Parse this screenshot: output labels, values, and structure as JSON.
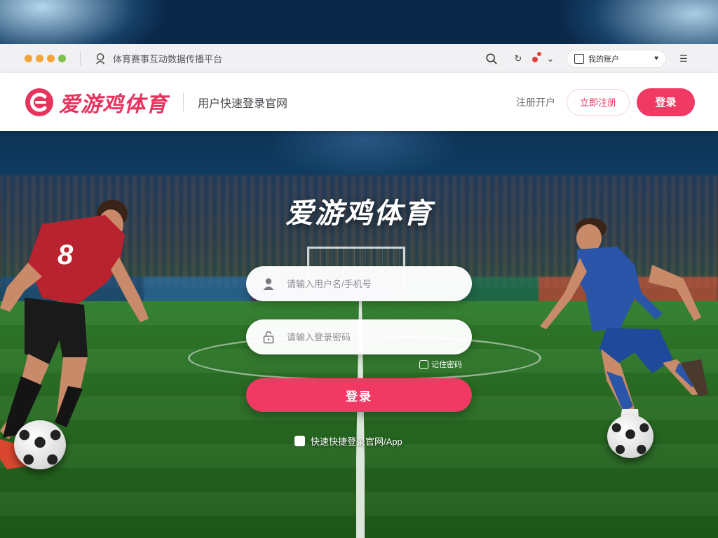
{
  "browser": {
    "dot_colors": [
      "#f2a53a",
      "#f2a53a",
      "#f2a53a",
      "#7cc24a"
    ],
    "address_text": "体育赛事互动数据传播平台",
    "profile_label": "我的账户"
  },
  "header": {
    "logo_text": "爱游鸡体育",
    "subtitle": "用户快速登录官网",
    "link_text": "注册开户",
    "register_label": "立即注册",
    "login_label": "登录",
    "accent_color": "#f03a64"
  },
  "login": {
    "title": "爱游鸡体育",
    "username_placeholder": "请输入用户名/手机号",
    "password_placeholder": "请输入登录密码",
    "remember_label": "记住密码",
    "submit_label": "登录",
    "footer_text": "快速快捷登录官网/App"
  },
  "players": [
    {
      "jersey_number": "8",
      "kit_color": "#b8232f"
    },
    {
      "jersey_number": "",
      "kit_color": "#2a55a8"
    }
  ]
}
